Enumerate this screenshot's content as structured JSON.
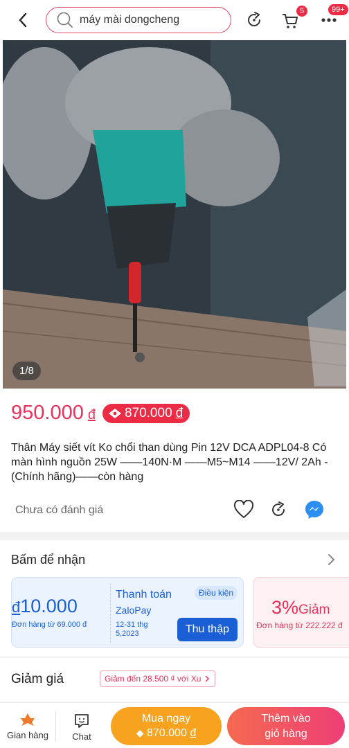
{
  "header": {
    "search_value": "máy mài dongcheng",
    "cart_badge": "5",
    "more_badge": "99+"
  },
  "gallery": {
    "pager": "1/8"
  },
  "price": {
    "original": "950.000",
    "original_currency": "đ",
    "voucher_price": "870.000",
    "voucher_currency": "đ"
  },
  "product": {
    "title": "Thân Máy siết vít Ko chổi than dùng Pin 12V DCA ADPL04-8 Có màn hình nguồn 25W ——140N·M  ——M5~M14 ——12V/ 2Ah -(Chính hãng)——còn hàng",
    "rating": "Chưa có đánh giá"
  },
  "claim": {
    "title": "Bấm để nhận",
    "voucher1": {
      "currency": "đ",
      "amount": "10.000",
      "min": "Đơn hàng từ 69.000 đ",
      "name": "Thanh toán",
      "provider": "ZaloPay",
      "condition": "Điều kiện",
      "date_line1": "12-31 thg",
      "date_line2": "5,2023",
      "button": "Thu thập"
    },
    "voucher2": {
      "amount": "3%",
      "label": "Giảm",
      "min": "Đơn hàng từ 222.222 đ"
    }
  },
  "discount": {
    "title": "Giảm giá",
    "tag": "Giảm đến 28.500 ₫ với Xu"
  },
  "bottom": {
    "store": "Gian hàng",
    "chat": "Chat",
    "buy_now": "Mua ngay",
    "buy_price": "870.000",
    "buy_currency": "đ",
    "add_cart_line1": "Thêm vào",
    "add_cart_line2": "giỏ hàng"
  },
  "colors": {
    "accent": "#e8315b",
    "buy": "#f8a31f",
    "zalopay": "#1a5fd6"
  }
}
